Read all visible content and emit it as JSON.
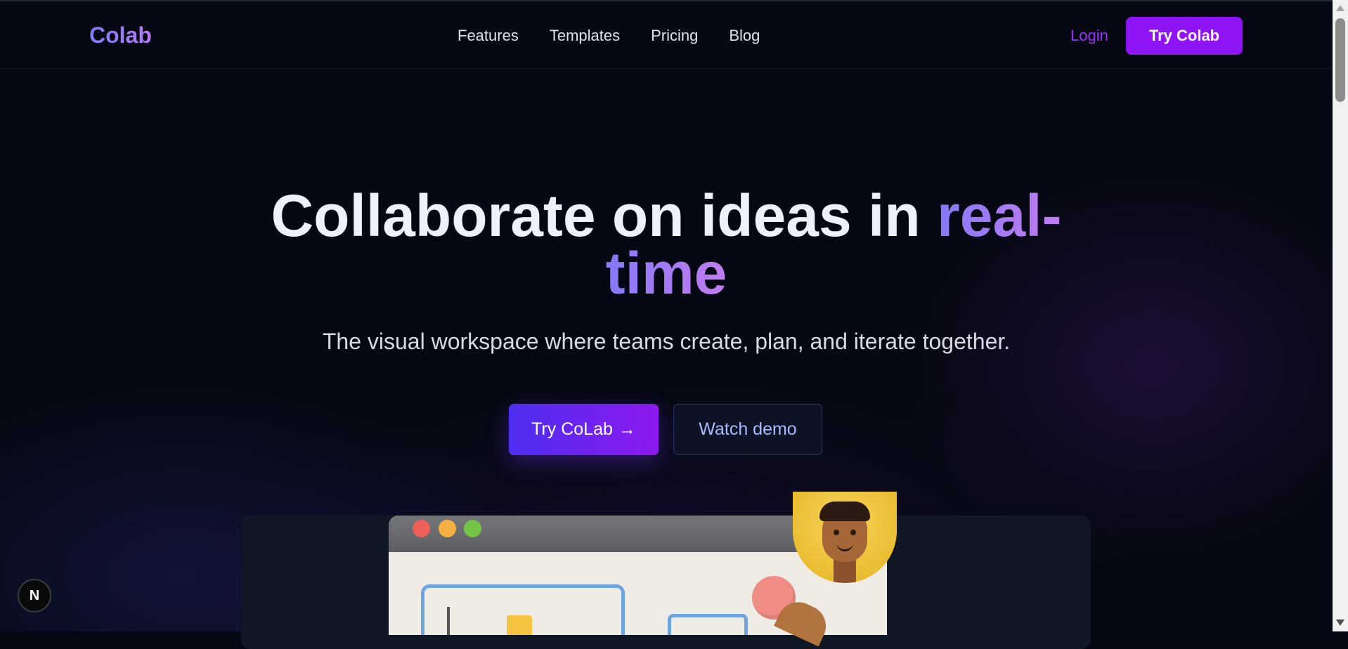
{
  "header": {
    "logo": "Colab",
    "nav": [
      "Features",
      "Templates",
      "Pricing",
      "Blog"
    ],
    "login": "Login",
    "cta": "Try Colab"
  },
  "hero": {
    "title_main": "Collaborate on ideas in ",
    "title_highlight_1": "real-",
    "title_highlight_2": "time",
    "subtitle": "The visual workspace where teams create, plan, and iterate together.",
    "primary_cta": "Try CoLab",
    "primary_cta_arrow": "→",
    "secondary_cta": "Watch demo"
  },
  "badge": {
    "letter": "N"
  },
  "colors": {
    "background": "#050812",
    "accent_purple": "#8f14f5",
    "gradient_start": "#4d2ef0",
    "gradient_end": "#8d19f0",
    "title_gradient_start": "#8579f7",
    "title_gradient_end": "#c37cf1",
    "window_dot_red": "#ee5f57",
    "window_dot_yellow": "#f4b142",
    "window_dot_green": "#76c34a"
  },
  "icons": [
    "n-logo-icon",
    "arrow-right-icon",
    "scroll-up-icon",
    "scroll-down-icon"
  ]
}
